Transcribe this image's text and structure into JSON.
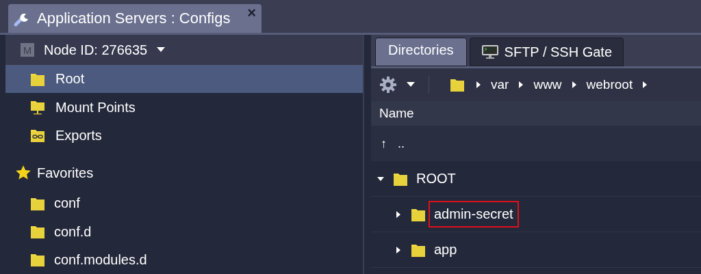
{
  "window": {
    "tab": {
      "title": "Application Servers : Configs",
      "close": "×"
    }
  },
  "sidebar": {
    "node": {
      "badge": "M",
      "label": "Node ID: 276635"
    },
    "items": [
      {
        "label": "Root",
        "kind": "folder",
        "selected": true
      },
      {
        "label": "Mount Points",
        "kind": "mount",
        "selected": false
      },
      {
        "label": "Exports",
        "kind": "export",
        "selected": false
      }
    ],
    "favorites": {
      "label": "Favorites",
      "items": [
        {
          "label": "conf",
          "selected": false
        },
        {
          "label": "conf.d",
          "selected": false
        },
        {
          "label": "conf.modules.d",
          "selected": false
        }
      ]
    }
  },
  "tabs": [
    {
      "label": "Directories",
      "kind": "plain",
      "selected": true
    },
    {
      "label": "SFTP / SSH Gate",
      "kind": "terminal",
      "selected": false
    }
  ],
  "breadcrumb": [
    "var",
    "www",
    "webroot"
  ],
  "table": {
    "columns": [
      "Name"
    ],
    "up": {
      "arrow": "↑",
      "label": ".."
    },
    "tree": [
      {
        "label": "ROOT",
        "expanded": true,
        "highlighted": false,
        "children": [
          {
            "label": "admin-secret",
            "expanded": false,
            "highlighted": true
          },
          {
            "label": "app",
            "expanded": false,
            "highlighted": false
          }
        ]
      }
    ]
  }
}
